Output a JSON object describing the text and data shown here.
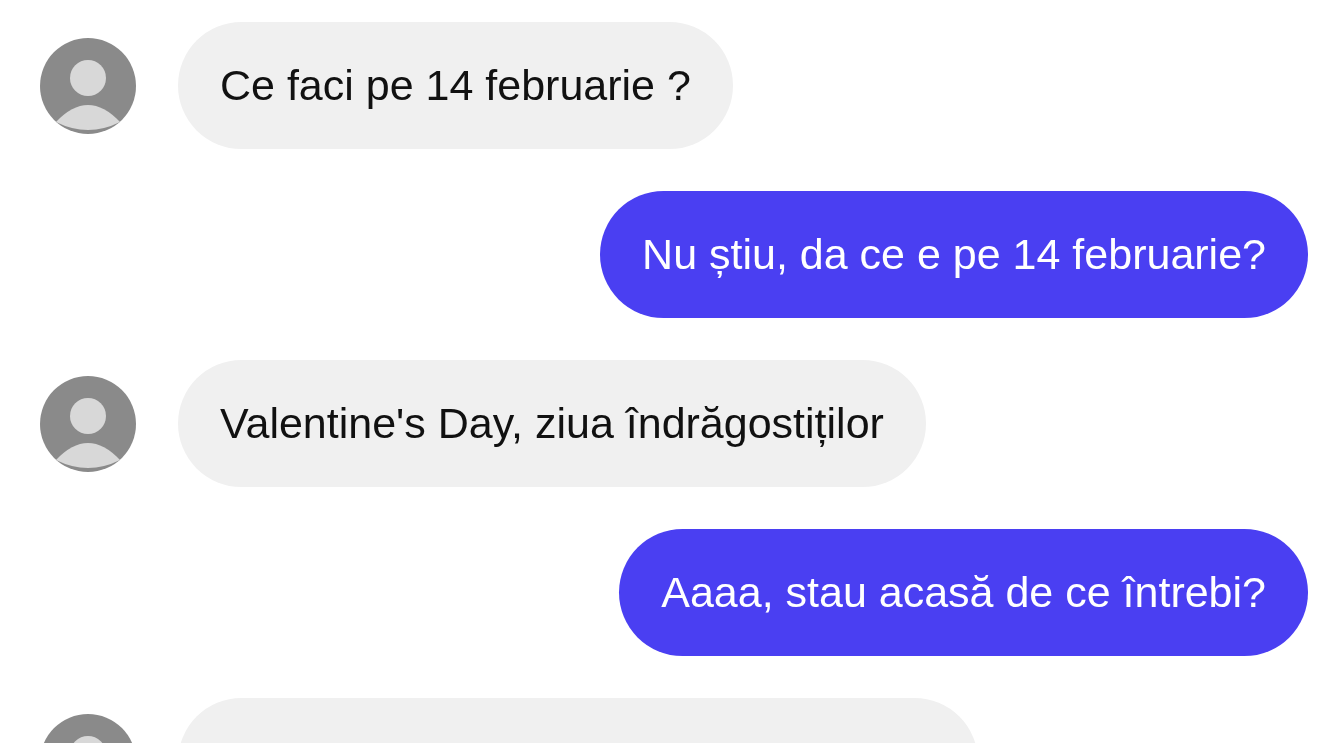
{
  "messages": [
    {
      "kind": "received",
      "text": "Ce faci pe 14 februarie ?"
    },
    {
      "kind": "sent",
      "text": "Nu știu, da ce e pe 14 februarie?"
    },
    {
      "kind": "received",
      "text": "Valentine's Day, ziua îndrăgostiților"
    },
    {
      "kind": "sent",
      "text": "Aaaa, stau acasă de ce întrebi?"
    },
    {
      "kind": "received"
    }
  ]
}
